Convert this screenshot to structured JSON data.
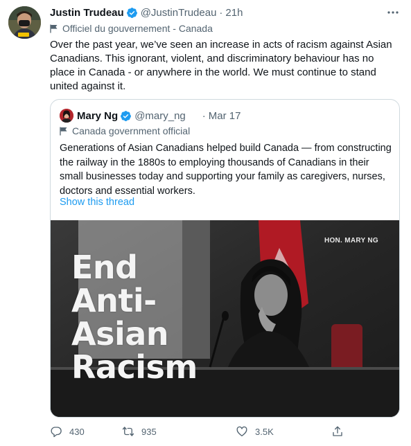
{
  "tweet": {
    "author_name": "Justin Trudeau",
    "handle": "@JustinTrudeau",
    "separator": "·",
    "time": "21h",
    "label": "Officiel du gouvernement - Canada",
    "text": "Over the past year, we’ve seen an increase in acts of racism against Asian Canadians. This ignorant, violent, and discriminatory behaviour has no place in Canada - or anywhere in the world. We must continue to stand united against it.",
    "avatar_icon": "profile-photo",
    "verified_icon": "verified-badge-icon",
    "more_icon": "more-icon"
  },
  "quote": {
    "author_name": "Mary Ng",
    "handle": "@mary_ng",
    "separator": "·",
    "time": "Mar 17",
    "label": "Canada government official",
    "text": "Generations of Asian Canadians helped build Canada — from constructing the railway in the 1880s to employing thousands of Canadians in their small businesses today and supporting your family as caregivers, nurses, doctors and essential workers.",
    "show_thread": "Show this thread",
    "media": {
      "title_lines": [
        "End",
        "Anti-",
        "Asian",
        "Racism"
      ],
      "caption": "HON. MARY NG"
    }
  },
  "actions": {
    "replies": "430",
    "retweets": "935",
    "likes": "3.5K"
  },
  "colors": {
    "accent": "#1d9bf0",
    "secondary_text": "#536471",
    "border": "#cfd9de"
  }
}
